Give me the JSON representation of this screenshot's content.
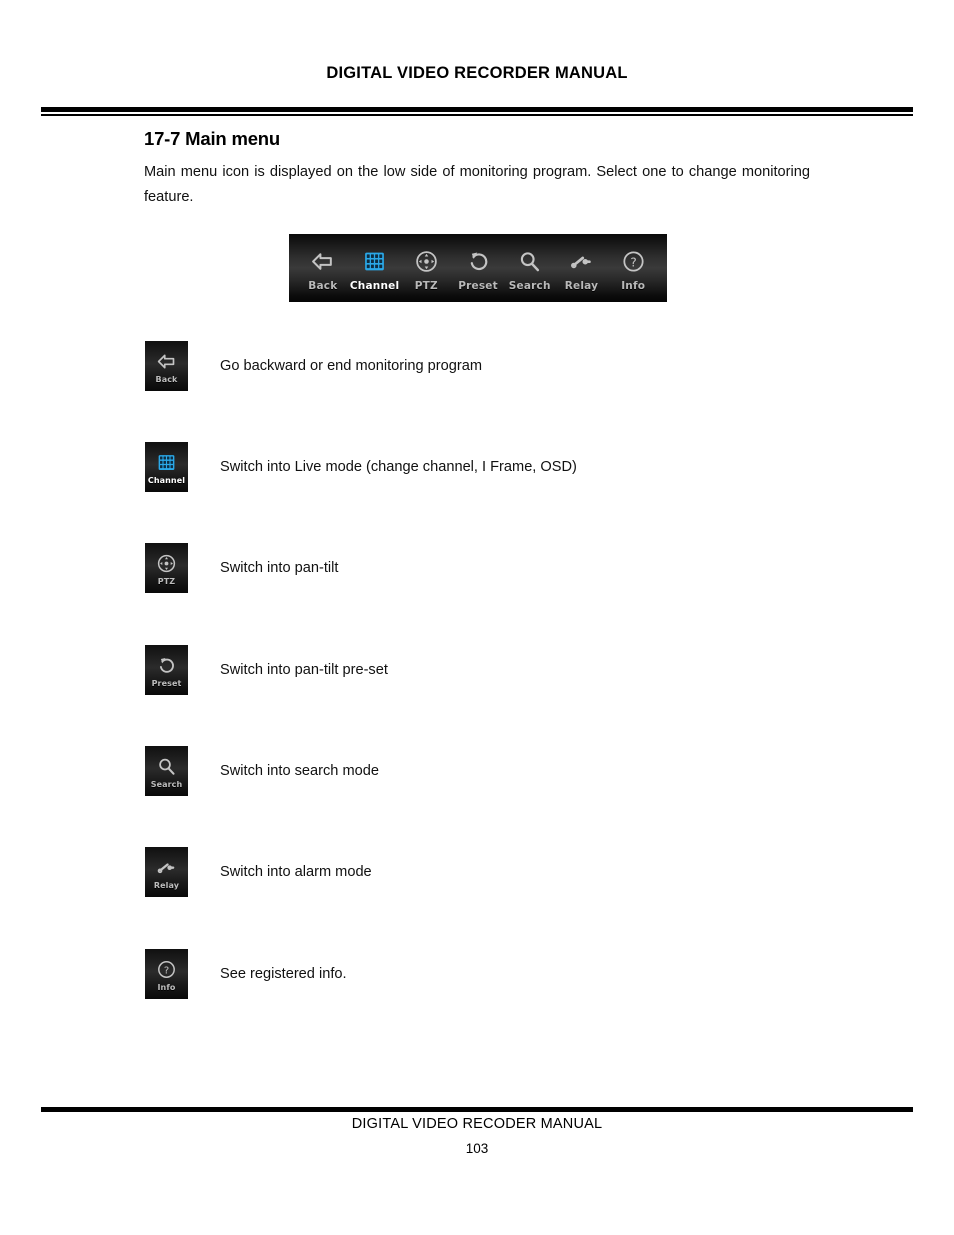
{
  "header": {
    "title": "DIGITAL VIDEO RECORDER MANUAL"
  },
  "section": {
    "title": "17-7 Main menu",
    "intro": "Main menu icon is displayed on the low side of monitoring program. Select one to change monitoring feature."
  },
  "toolbar": {
    "items": [
      {
        "label": "Back",
        "icon": "back-arrow-icon",
        "active": false
      },
      {
        "label": "Channel",
        "icon": "grid-icon",
        "active": true
      },
      {
        "label": "PTZ",
        "icon": "pan-tilt-icon",
        "active": false
      },
      {
        "label": "Preset",
        "icon": "rotate-arrow-icon",
        "active": false
      },
      {
        "label": "Search",
        "icon": "magnifier-icon",
        "active": false
      },
      {
        "label": "Relay",
        "icon": "relay-switch-icon",
        "active": false
      },
      {
        "label": "Info",
        "icon": "question-mark-icon",
        "active": false
      }
    ]
  },
  "legend": {
    "rows": [
      {
        "label": "Back",
        "icon": "back-arrow-icon",
        "description": "Go backward or end monitoring program"
      },
      {
        "label": "Channel",
        "icon": "grid-icon",
        "description": "Switch into Live mode (change channel, I Frame, OSD)"
      },
      {
        "label": "PTZ",
        "icon": "pan-tilt-icon",
        "description": "Switch into pan-tilt"
      },
      {
        "label": "Preset",
        "icon": "rotate-arrow-icon",
        "description": "Switch into pan-tilt pre-set"
      },
      {
        "label": "Search",
        "icon": "magnifier-icon",
        "description": "Switch into search mode"
      },
      {
        "label": "Relay",
        "icon": "relay-switch-icon",
        "description": "Switch into alarm mode"
      },
      {
        "label": "Info",
        "icon": "question-mark-icon",
        "description": "See registered info."
      }
    ]
  },
  "footer": {
    "title": "DIGITAL VIDEO RECODER MANUAL",
    "page_number": "103"
  },
  "colors": {
    "channel_blue": "#2aa8e8",
    "icon_gray": "#c4c4c4",
    "tile_dark": "#151515"
  }
}
